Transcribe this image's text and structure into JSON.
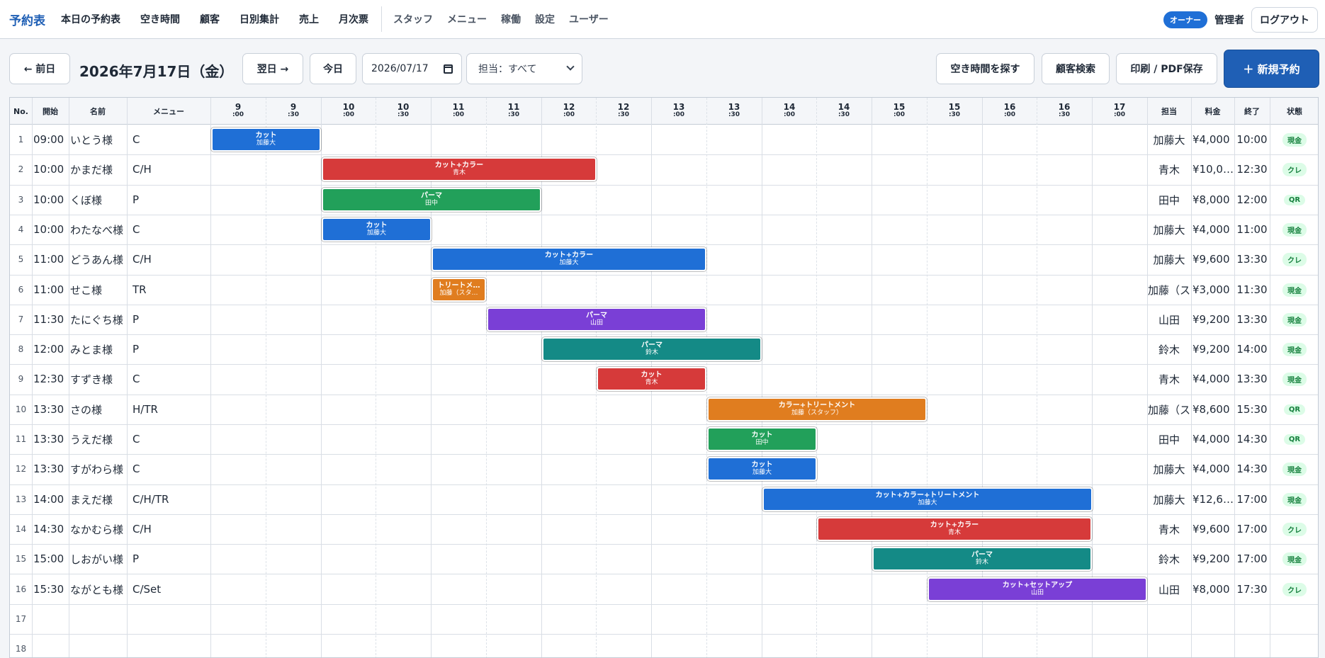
{
  "nav": {
    "brand": "予約表",
    "items": [
      "本日の予約表",
      "空き時間",
      "顧客",
      "日別集計",
      "売上",
      "月次票"
    ],
    "admin_items": [
      "スタッフ",
      "メニュー",
      "稼働",
      "設定",
      "ユーザー"
    ],
    "role_badge": "オーナー",
    "user_label": "管理者",
    "logout": "ログアウト"
  },
  "toolbar": {
    "prev": "← 前日",
    "date_title": "2026年7月17日（金）",
    "next": "翌日 →",
    "today": "今日",
    "date_value": "2026/07/17",
    "staff_filter": "担当：すべて",
    "find_free": "空き時間を探す",
    "customer_search": "顧客検索",
    "print": "印刷 / PDF保存",
    "new_booking": "＋ 新規予約"
  },
  "table": {
    "headers": {
      "no": "No.",
      "start": "開始",
      "name": "名前",
      "menu": "メニュー",
      "staff": "担当",
      "price": "料金",
      "end": "終了",
      "status": "状態"
    },
    "time_columns": [
      {
        "h": "9",
        "m": ":00"
      },
      {
        "h": "9",
        "m": ":30"
      },
      {
        "h": "10",
        "m": ":00"
      },
      {
        "h": "10",
        "m": ":30"
      },
      {
        "h": "11",
        "m": ":00"
      },
      {
        "h": "11",
        "m": ":30"
      },
      {
        "h": "12",
        "m": ":00"
      },
      {
        "h": "12",
        "m": ":30"
      },
      {
        "h": "13",
        "m": ":00"
      },
      {
        "h": "13",
        "m": ":30"
      },
      {
        "h": "14",
        "m": ":00"
      },
      {
        "h": "14",
        "m": ":30"
      },
      {
        "h": "15",
        "m": ":00"
      },
      {
        "h": "15",
        "m": ":30"
      },
      {
        "h": "16",
        "m": ":00"
      },
      {
        "h": "16",
        "m": ":30"
      },
      {
        "h": "17",
        "m": ":00"
      }
    ],
    "rows": [
      {
        "no": "1",
        "start": "09:00",
        "name": "いとう様",
        "menu": "C",
        "staff": "加藤大",
        "price": "¥4,000",
        "end": "10:00",
        "status": "現金",
        "bar": {
          "service": "カット",
          "staff": "加藤大",
          "from": "09:00",
          "to": "10:00",
          "color": "#1f6fd6"
        }
      },
      {
        "no": "2",
        "start": "10:00",
        "name": "かまだ様",
        "menu": "C/H",
        "staff": "青木",
        "price": "¥10,0…",
        "end": "12:30",
        "status": "クレ",
        "bar": {
          "service": "カット+カラー",
          "staff": "青木",
          "from": "10:00",
          "to": "12:30",
          "color": "#d63a3a"
        }
      },
      {
        "no": "3",
        "start": "10:00",
        "name": "くぼ様",
        "menu": "P",
        "staff": "田中",
        "price": "¥8,000",
        "end": "12:00",
        "status": "QR",
        "bar": {
          "service": "パーマ",
          "staff": "田中",
          "from": "10:00",
          "to": "12:00",
          "color": "#22a05a"
        }
      },
      {
        "no": "4",
        "start": "10:00",
        "name": "わたなべ様",
        "menu": "C",
        "staff": "加藤大",
        "price": "¥4,000",
        "end": "11:00",
        "status": "現金",
        "bar": {
          "service": "カット",
          "staff": "加藤大",
          "from": "10:00",
          "to": "11:00",
          "color": "#1f6fd6"
        }
      },
      {
        "no": "5",
        "start": "11:00",
        "name": "どうあん様",
        "menu": "C/H",
        "staff": "加藤大",
        "price": "¥9,600",
        "end": "13:30",
        "status": "クレ",
        "bar": {
          "service": "カット+カラー",
          "staff": "加藤大",
          "from": "11:00",
          "to": "13:30",
          "color": "#1f6fd6"
        }
      },
      {
        "no": "6",
        "start": "11:00",
        "name": "せこ様",
        "menu": "TR",
        "staff": "加藤（ス",
        "price": "¥3,000",
        "end": "11:30",
        "status": "現金",
        "bar": {
          "service": "トリートメ…",
          "staff": "加藤（スタ…",
          "from": "11:00",
          "to": "11:30",
          "color": "#e07d1f"
        }
      },
      {
        "no": "7",
        "start": "11:30",
        "name": "たにぐち様",
        "menu": "P",
        "staff": "山田",
        "price": "¥9,200",
        "end": "13:30",
        "status": "現金",
        "bar": {
          "service": "パーマ",
          "staff": "山田",
          "from": "11:30",
          "to": "13:30",
          "color": "#7a3fd6"
        }
      },
      {
        "no": "8",
        "start": "12:00",
        "name": "みとま様",
        "menu": "P",
        "staff": "鈴木",
        "price": "¥9,200",
        "end": "14:00",
        "status": "現金",
        "bar": {
          "service": "パーマ",
          "staff": "鈴木",
          "from": "12:00",
          "to": "14:00",
          "color": "#148a86"
        }
      },
      {
        "no": "9",
        "start": "12:30",
        "name": "すずき様",
        "menu": "C",
        "staff": "青木",
        "price": "¥4,000",
        "end": "13:30",
        "status": "現金",
        "bar": {
          "service": "カット",
          "staff": "青木",
          "from": "12:30",
          "to": "13:30",
          "color": "#d63a3a"
        }
      },
      {
        "no": "10",
        "start": "13:30",
        "name": "さの様",
        "menu": "H/TR",
        "staff": "加藤（ス",
        "price": "¥8,600",
        "end": "15:30",
        "status": "QR",
        "bar": {
          "service": "カラー+トリートメント",
          "staff": "加藤（スタッフ）",
          "from": "13:30",
          "to": "15:30",
          "color": "#e07d1f"
        }
      },
      {
        "no": "11",
        "start": "13:30",
        "name": "うえだ様",
        "menu": "C",
        "staff": "田中",
        "price": "¥4,000",
        "end": "14:30",
        "status": "QR",
        "bar": {
          "service": "カット",
          "staff": "田中",
          "from": "13:30",
          "to": "14:30",
          "color": "#22a05a"
        }
      },
      {
        "no": "12",
        "start": "13:30",
        "name": "すがわら様",
        "menu": "C",
        "staff": "加藤大",
        "price": "¥4,000",
        "end": "14:30",
        "status": "現金",
        "bar": {
          "service": "カット",
          "staff": "加藤大",
          "from": "13:30",
          "to": "14:30",
          "color": "#1f6fd6"
        }
      },
      {
        "no": "13",
        "start": "14:00",
        "name": "まえだ様",
        "menu": "C/H/TR",
        "staff": "加藤大",
        "price": "¥12,6…",
        "end": "17:00",
        "status": "現金",
        "bar": {
          "service": "カット+カラー+トリートメント",
          "staff": "加藤大",
          "from": "14:00",
          "to": "17:00",
          "color": "#1f6fd6"
        }
      },
      {
        "no": "14",
        "start": "14:30",
        "name": "なかむら様",
        "menu": "C/H",
        "staff": "青木",
        "price": "¥9,600",
        "end": "17:00",
        "status": "クレ",
        "bar": {
          "service": "カット+カラー",
          "staff": "青木",
          "from": "14:30",
          "to": "17:00",
          "color": "#d63a3a"
        }
      },
      {
        "no": "15",
        "start": "15:00",
        "name": "しおがい様",
        "menu": "P",
        "staff": "鈴木",
        "price": "¥9,200",
        "end": "17:00",
        "status": "現金",
        "bar": {
          "service": "パーマ",
          "staff": "鈴木",
          "from": "15:00",
          "to": "17:00",
          "color": "#148a86"
        }
      },
      {
        "no": "16",
        "start": "15:30",
        "name": "ながとも様",
        "menu": "C/Set",
        "staff": "山田",
        "price": "¥8,000",
        "end": "17:30",
        "status": "クレ",
        "bar": {
          "service": "カット+セットアップ",
          "staff": "山田",
          "from": "15:30",
          "to": "17:30",
          "color": "#7a3fd6"
        }
      },
      {
        "no": "17"
      },
      {
        "no": "18"
      }
    ]
  }
}
